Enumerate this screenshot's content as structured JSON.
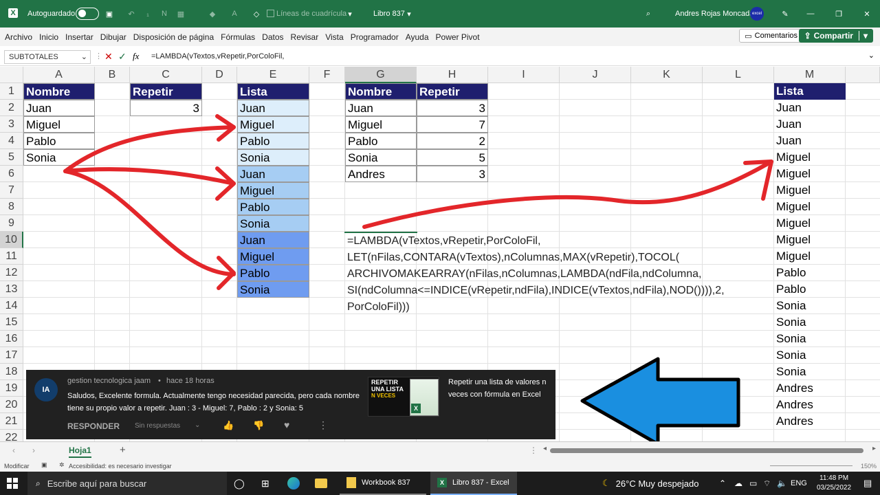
{
  "titlebar": {
    "autosave_label": "Autoguardado",
    "gridlines_label": "Líneas de cuadrícula",
    "book_name": "Libro 837",
    "user_name": "Andres Rojas Moncada",
    "avatar_text": "excel"
  },
  "ribbon_tabs": [
    "Archivo",
    "Inicio",
    "Insertar",
    "Dibujar",
    "Disposición de página",
    "Fórmulas",
    "Datos",
    "Revisar",
    "Vista",
    "Programador",
    "Ayuda",
    "Power Pivot"
  ],
  "buttons": {
    "comments": "Comentarios",
    "share": "Compartir"
  },
  "formula_bar": {
    "name_box": "SUBTOTALES",
    "cancel_symbol": "✕",
    "enter_symbol": "✓",
    "fx_symbol": "fx",
    "formula": "=LAMBDA(vTextos,vRepetir,PorColoFil,"
  },
  "columns": [
    "A",
    "B",
    "C",
    "D",
    "E",
    "F",
    "G",
    "H",
    "I",
    "J",
    "K",
    "L",
    "M"
  ],
  "rows": [
    "1",
    "2",
    "3",
    "4",
    "5",
    "6",
    "7",
    "8",
    "9",
    "10",
    "11",
    "12",
    "13",
    "14",
    "15",
    "16",
    "17",
    "18",
    "19",
    "20",
    "21",
    "22"
  ],
  "table_nombre": {
    "header": "Nombre",
    "values": [
      "Juan",
      "Miguel",
      "Pablo",
      "Sonia"
    ]
  },
  "table_repetir": {
    "header": "Repetir",
    "value": "3"
  },
  "table_lista": {
    "header": "Lista",
    "values": [
      "Juan",
      "Miguel",
      "Pablo",
      "Sonia",
      "Juan",
      "Miguel",
      "Pablo",
      "Sonia",
      "Juan",
      "Miguel",
      "Pablo",
      "Sonia"
    ]
  },
  "table_gh": {
    "header_nombre": "Nombre",
    "header_repetir": "Repetir",
    "names": [
      "Juan",
      "Miguel",
      "Pablo",
      "Sonia",
      "Andres"
    ],
    "reps": [
      "3",
      "7",
      "2",
      "5",
      "3"
    ]
  },
  "formula_lines": [
    "=LAMBDA(vTextos,vRepetir,PorColoFil,",
    "LET(nFilas,CONTARA(vTextos),nColumnas,MAX(vRepetir),TOCOL(",
    "ARCHIVOMAKEARRAY(nFilas,nColumnas,LAMBDA(ndFila,ndColumna,",
    "SI(ndColumna<=INDICE(vRepetir,ndFila),INDICE(vTextos,ndFila),NOD()))),2,",
    "PorColoFil)))"
  ],
  "table_m": {
    "header": "Lista",
    "values": [
      "Juan",
      "Juan",
      "Juan",
      "Miguel",
      "Miguel",
      "Miguel",
      "Miguel",
      "Miguel",
      "Miguel",
      "Miguel",
      "Pablo",
      "Pablo",
      "Sonia",
      "Sonia",
      "Sonia",
      "Sonia",
      "Sonia",
      "Andres",
      "Andres",
      "Andres"
    ]
  },
  "comment": {
    "avatar_text": "IA",
    "author": "gestion tecnologica jaam",
    "sep": "•",
    "time": "hace 18 horas",
    "line1": "Saludos, Excelente formula. Actualmente tengo necesidad parecida, pero cada nombre",
    "line2": "tiene su propio valor a repetir.  Juan : 3 - Miguel: 7, Pablo : 2 y Sonia: 5",
    "reply": "RESPONDER",
    "no_replies": "Sin respuestas",
    "thumb_line1": "REPETIR",
    "thumb_line2": "UNA LISTA",
    "thumb_line3": "N VECES",
    "video_title_1": "Repetir una lista de valores n",
    "video_title_2": "veces con fórmula en Excel"
  },
  "sheet_tab": "Hoja1",
  "add_sheet": "+",
  "status": {
    "mode": "Modificar",
    "accessibility": "Accesibilidad: es necesario investigar",
    "zoom": "150%"
  },
  "taskbar": {
    "search_placeholder": "Escribe aquí para buscar",
    "app1": "Workbook 837",
    "app2": "Libro 837 - Excel",
    "weather": "26°C  Muy despejado",
    "lang": "ENG",
    "time": "11:48 PM",
    "date": "03/25/2022"
  },
  "colors": {
    "excel_green": "#217346",
    "header_navy": "#1f1f6e",
    "arrow_red": "#e3262a",
    "arrow_blue": "#1a8fe0",
    "lista_group1": "#ddeefb",
    "lista_group2": "#a6cdf3",
    "lista_group3": "#6f9cf0"
  }
}
